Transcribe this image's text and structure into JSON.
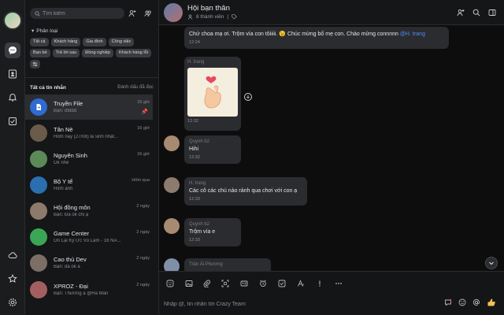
{
  "sidebar": {
    "search_placeholder": "Tìm kiếm",
    "category_label": "Phân loại",
    "chips": [
      "Tất cả",
      "Khách hàng",
      "Gia đình",
      "Công việc",
      "Bạn bè",
      "Trả lời sau",
      "Đồng nghiệp",
      "Khách hàng lỗi"
    ],
    "all_messages_label": "Tất cả tin nhắn",
    "mark_read_label": "Đánh dấu đã đọc",
    "conversations": [
      {
        "name": "Truyền File",
        "preview": "Bạn: dfddd",
        "time": "16 giờ",
        "color": "#3a7bd5"
      },
      {
        "name": "Tân Nè",
        "preview": "Hôm nay (27/08) là sinh nhật...",
        "time": "16 giờ",
        "color": "#6b5b4b"
      },
      {
        "name": "Nguyên Sinh",
        "preview": "Ok nhé",
        "time": "16 giờ",
        "color": "#5b8a58"
      },
      {
        "name": "Bộ Y tế",
        "preview": "Hình ảnh",
        "time": "Hôm qua",
        "color": "#2a6fb0"
      },
      {
        "name": "Hội đồng môn",
        "preview": "Bạn: Đa ok chị ạ",
        "time": "2 ngày",
        "color": "#8c7a6a"
      },
      {
        "name": "Game Center",
        "preview": "Ôn Lại Ký Ức Võ Lâm - 16 NĂ...",
        "time": "2 ngày",
        "color": "#3aa655"
      },
      {
        "name": "Cao thủ Dev",
        "preview": "Bạn: da ok a",
        "time": "2 ngày",
        "color": "#7d6f65"
      },
      {
        "name": "XPROZ - Đại",
        "preview": "Bạn: Thương a @Hà Mẫn",
        "time": "2 ngày",
        "color": "#a35f5f"
      }
    ]
  },
  "chat": {
    "title": "Hội bạn thân",
    "members": "8 thành viên",
    "messages": [
      {
        "sender": "",
        "text": "Chứ choa mạ ơi.  Trộm vía con tôiiiii. 😉 Chúc mừng bố mẹ con. Chào mừng connnnn",
        "mention": "@H. trang",
        "time": "12:24"
      },
      {
        "sender": "H. trang",
        "text": "",
        "time": "12:32",
        "sticker": true
      },
      {
        "sender": "Quynh b2",
        "text": "Hihi",
        "time": "12:32"
      },
      {
        "sender": "H. trang",
        "text": "Các cô các chú nào rảnh qua chơi với con ạ",
        "time": "12:33"
      },
      {
        "sender": "Quynh b2",
        "text": "Trộm vía e",
        "time": "12:33"
      },
      {
        "sender": "Trần Ái Phương",
        "text": "",
        "time": ""
      }
    ],
    "composer_placeholder": "Nhập @, tin nhắn tới Crazy Team"
  },
  "colors": {
    "accent": "#4d8ff5",
    "background": "#0d0d0e",
    "bubble": "#2b2c30"
  }
}
